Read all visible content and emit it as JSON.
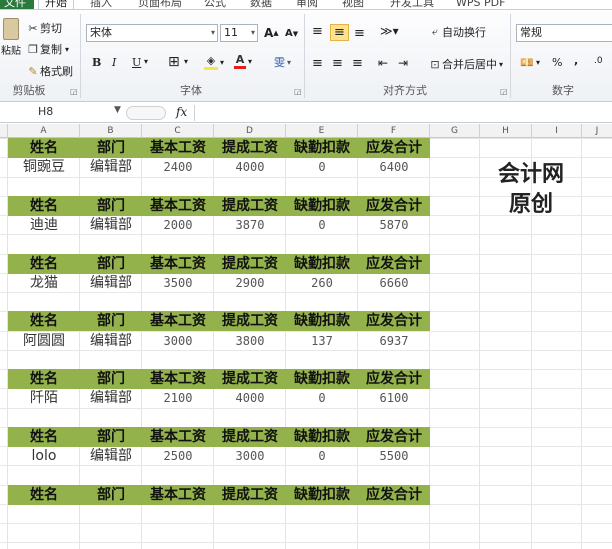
{
  "tabs": {
    "file": "文件",
    "start": "开始",
    "insert": "插入",
    "layout": "页面布局",
    "formula": "公式",
    "data": "数据",
    "review": "审阅",
    "view": "视图",
    "developer": "开发工具",
    "wps": "WPS PDF"
  },
  "ribbon": {
    "clipboard": {
      "paste": "粘贴",
      "cut": "剪切",
      "copy": "复制",
      "format_painter": "格式刷",
      "group_label": "剪贴板"
    },
    "font": {
      "name": "宋体",
      "size": "11",
      "group_label": "字体",
      "bold": "B",
      "italic": "I",
      "underline": "U",
      "grow": "A",
      "shrink": "A",
      "phonetic": "雯"
    },
    "alignment": {
      "wrap": "自动换行",
      "merge": "合并后居中",
      "group_label": "对齐方式"
    },
    "number": {
      "format": "常规",
      "group_label": "数字",
      "percent": "%",
      "comma": ","
    }
  },
  "formula_bar": {
    "name_box": "H8",
    "fx": "fx"
  },
  "columns": [
    "A",
    "B",
    "C",
    "D",
    "E",
    "F",
    "G",
    "H",
    "I",
    "J"
  ],
  "headers": [
    "姓名",
    "部门",
    "基本工资",
    "提成工资",
    "缺勤扣款",
    "应发合计"
  ],
  "records": [
    {
      "name": "铜豌豆",
      "dept": "编辑部",
      "base": "2400",
      "bonus": "4000",
      "deduct": "0",
      "total": "6400"
    },
    {
      "name": "迪迪",
      "dept": "编辑部",
      "base": "2000",
      "bonus": "3870",
      "deduct": "0",
      "total": "5870"
    },
    {
      "name": "龙猫",
      "dept": "编辑部",
      "base": "3500",
      "bonus": "2900",
      "deduct": "260",
      "total": "6660"
    },
    {
      "name": "阿圆圆",
      "dept": "编辑部",
      "base": "3000",
      "bonus": "3800",
      "deduct": "137",
      "total": "6937"
    },
    {
      "name": "阡陌",
      "dept": "编辑部",
      "base": "2100",
      "bonus": "4000",
      "deduct": "0",
      "total": "6100"
    },
    {
      "name": "lolo",
      "dept": "编辑部",
      "base": "2500",
      "bonus": "3000",
      "deduct": "0",
      "total": "5500"
    }
  ],
  "watermark": {
    "line1": "会计网",
    "line2": "原创"
  },
  "colors": {
    "header_fill": "#93b24c",
    "file_tab": "#2b7a3d"
  }
}
